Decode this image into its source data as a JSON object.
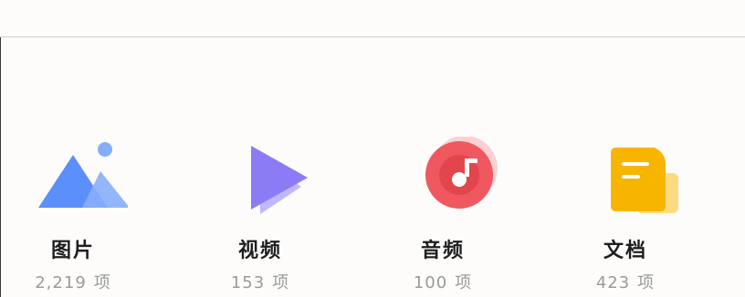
{
  "categories": [
    {
      "label": "图片",
      "count": "2,219",
      "unit": "项",
      "icon": "image-icon",
      "color": "#5b8ff9"
    },
    {
      "label": "视频",
      "count": "153",
      "unit": "项",
      "icon": "video-play-icon",
      "color": "#8b7cf6"
    },
    {
      "label": "音频",
      "count": "100",
      "unit": "项",
      "icon": "music-disc-icon",
      "color": "#f0575f"
    },
    {
      "label": "文档",
      "count": "423",
      "unit": "项",
      "icon": "document-icon",
      "color": "#f7b500"
    }
  ]
}
